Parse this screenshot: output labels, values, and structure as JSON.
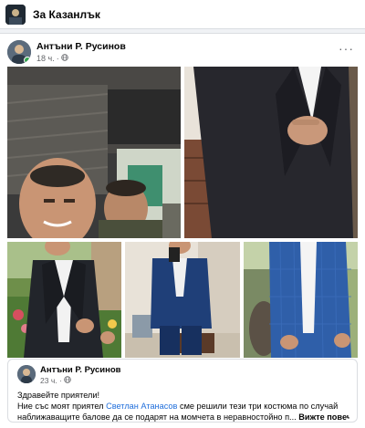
{
  "group": {
    "name": "За Казанлък"
  },
  "post": {
    "author": "Антъни Р. Русинов",
    "time": "18 ч.",
    "more_label": "···",
    "privacy_icon": "globe-icon"
  },
  "shared": {
    "author": "Антъни Р. Русинов",
    "time": "23 ч.",
    "greeting": "Здравейте приятели!",
    "text_before": "Ние със моят приятел ",
    "mention": "Светлан Атанасов",
    "text_after": " сме решили тези три костюма по случай",
    "line3": "наближаващите балове да се подарят на момчета в неравностойно п...",
    "see_more": "Вижте повече"
  },
  "colors": {
    "link": "#216fdb",
    "secondary": "#65676b",
    "border": "#dadde1"
  }
}
